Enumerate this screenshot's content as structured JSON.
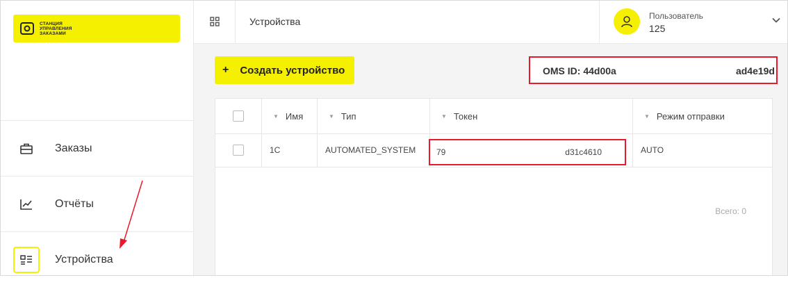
{
  "logo": {
    "lines": [
      "СТАНЦИЯ",
      "УПРАВЛЕНИЯ",
      "ЗАКАЗАМИ"
    ],
    "color": "#f5f000"
  },
  "sidebar": {
    "items": [
      {
        "label": "Заказы",
        "icon": "briefcase-icon",
        "active": false
      },
      {
        "label": "Отчёты",
        "icon": "chart-icon",
        "active": false
      },
      {
        "label": "Устройства",
        "icon": "devices-icon",
        "active": true
      }
    ]
  },
  "header": {
    "title": "Устройства",
    "grid_icon": "grid-icon",
    "user": {
      "role": "Пользователь",
      "id": "125"
    }
  },
  "actions": {
    "create_plus": "+",
    "create_label": "Создать устройство"
  },
  "oms": {
    "left": "OMS ID: 44d00a",
    "right": "ad4e19d"
  },
  "table": {
    "columns": [
      "Имя",
      "Тип",
      "Токен",
      "Режим отправки"
    ],
    "rows": [
      {
        "name": "1C",
        "type": "AUTOMATED_SYSTEM",
        "token_start": "79",
        "token_end": "d31c4610",
        "mode": "AUTO"
      }
    ],
    "total": "Всего: 0"
  },
  "colors": {
    "accent": "#f5f000",
    "highlight": "#e8192c"
  }
}
